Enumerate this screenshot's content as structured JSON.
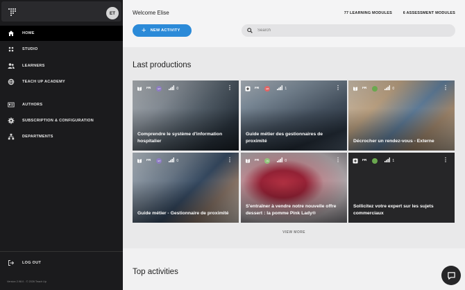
{
  "sidebar": {
    "avatar_initials": "ET",
    "items": [
      {
        "label": "HOME",
        "icon": "home-icon",
        "active": true
      },
      {
        "label": "STUDIO",
        "icon": "grid-icon",
        "active": false
      },
      {
        "label": "LEARNERS",
        "icon": "users-icon",
        "active": false
      },
      {
        "label": "TEACH UP ACADEMY",
        "icon": "globe-icon",
        "active": false
      },
      {
        "label": "AUTHORS",
        "icon": "id-card-icon",
        "active": false
      },
      {
        "label": "SUBSCRIPTION & CONFIGURATION",
        "icon": "gear-icon",
        "active": false
      },
      {
        "label": "DEPARTMENTS",
        "icon": "hierarchy-icon",
        "active": false
      }
    ],
    "logout_label": "LOG OUT",
    "version": "Version 2.98.0 - © 2026 Teach Up"
  },
  "header": {
    "welcome": "Welcome Elise",
    "learning_modules": "77 LEARNING MODULES",
    "assessment_modules": "6 ASSESSMENT MODULES",
    "new_activity_label": "NEW ACTIVITY",
    "search_placeholder": "Search"
  },
  "main": {
    "last_productions_title": "Last productions",
    "view_more_label": "VIEW MORE",
    "top_activities_title": "Top activities"
  },
  "cards": [
    {
      "title": "Comprendre le système d'information hospitalier",
      "type_icon": "book-icon",
      "lang": "FR",
      "author_color": "#8e7cc3",
      "author_initials": "ET",
      "count": "0"
    },
    {
      "title": "Guide métier des gestionnaires de proximité",
      "type_icon": "plus-square-icon",
      "lang": "FR",
      "author_color": "#e06666",
      "author_initials": "EB",
      "count": "1"
    },
    {
      "title": "Décrocher un rendez-vous - Externe",
      "type_icon": "book-icon",
      "lang": "FR",
      "author_color": "#6aa84f",
      "author_initials": "",
      "count": "0"
    },
    {
      "title": "Guide métier - Gestionnaire de proximité",
      "type_icon": "book-icon",
      "lang": "FR",
      "author_color": "#8e7cc3",
      "author_initials": "ET",
      "count": "0"
    },
    {
      "title": "S'entraîner à vendre notre nouvelle offre dessert : la pomme Pink Lady®",
      "type_icon": "book-icon",
      "lang": "FR",
      "author_color": "#93c47d",
      "author_initials": "JG",
      "count": "0"
    },
    {
      "title": "Sollicitez votre expert sur les sujets commerciaux",
      "type_icon": "plus-square-icon",
      "lang": "FR",
      "author_color": "#6aa84f",
      "author_initials": "",
      "count": "1"
    }
  ],
  "colors": {
    "accent": "#2b8ad8",
    "sidebar": "#1b1b1d"
  }
}
